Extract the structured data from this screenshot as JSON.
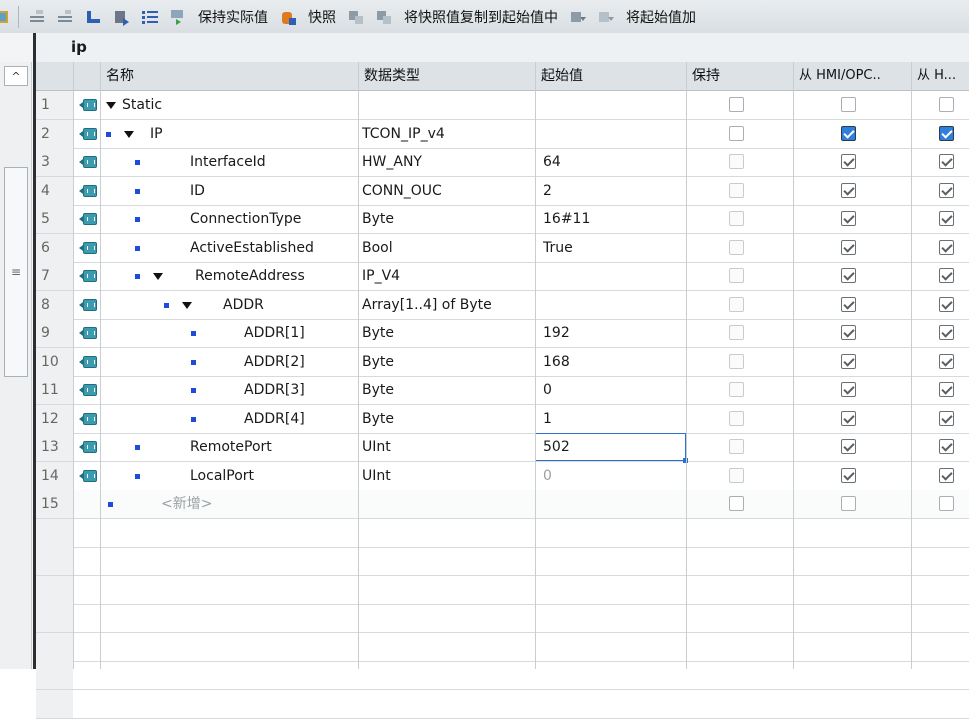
{
  "toolbar": {
    "keep_actual_label": "保持实际值",
    "snapshot_label": "快照",
    "copy_snapshot_label": "将快照值复制到起始值中",
    "load_start_label": "将起始值加"
  },
  "block": {
    "name": "ip"
  },
  "table": {
    "headers": {
      "name": "名称",
      "datatype": "数据类型",
      "start_value": "起始值",
      "retain": "保持",
      "hmi_opc": "从 HMI/OPC..",
      "hmi2": "从 H..."
    },
    "rows": [
      {
        "num": "1",
        "name": "Static",
        "type": "",
        "value": "",
        "retain": "off",
        "hmi": "off",
        "h": "off"
      },
      {
        "num": "2",
        "name": "IP",
        "type": "TCON_IP_v4",
        "value": "",
        "retain": "off",
        "hmi": "on",
        "h": "on"
      },
      {
        "num": "3",
        "name": "InterfaceId",
        "type": "HW_ANY",
        "value": "64",
        "retain": "off",
        "hmi": "on",
        "h": "on"
      },
      {
        "num": "4",
        "name": "ID",
        "type": "CONN_OUC",
        "value": "2",
        "retain": "off",
        "hmi": "on",
        "h": "on"
      },
      {
        "num": "5",
        "name": "ConnectionType",
        "type": "Byte",
        "value": "16#11",
        "retain": "off",
        "hmi": "on",
        "h": "on"
      },
      {
        "num": "6",
        "name": "ActiveEstablished",
        "type": "Bool",
        "value": "True",
        "retain": "off",
        "hmi": "on",
        "h": "on"
      },
      {
        "num": "7",
        "name": "RemoteAddress",
        "type": "IP_V4",
        "value": "",
        "retain": "off",
        "hmi": "on",
        "h": "on"
      },
      {
        "num": "8",
        "name": "ADDR",
        "type": "Array[1..4] of Byte",
        "value": "",
        "retain": "off",
        "hmi": "on",
        "h": "on"
      },
      {
        "num": "9",
        "name": "ADDR[1]",
        "type": "Byte",
        "value": "192",
        "retain": "off",
        "hmi": "on",
        "h": "on"
      },
      {
        "num": "10",
        "name": "ADDR[2]",
        "type": "Byte",
        "value": "168",
        "retain": "off",
        "hmi": "on",
        "h": "on"
      },
      {
        "num": "11",
        "name": "ADDR[3]",
        "type": "Byte",
        "value": "0",
        "retain": "off",
        "hmi": "on",
        "h": "on"
      },
      {
        "num": "12",
        "name": "ADDR[4]",
        "type": "Byte",
        "value": "1",
        "retain": "off",
        "hmi": "on",
        "h": "on"
      },
      {
        "num": "13",
        "name": "RemotePort",
        "type": "UInt",
        "value": "502",
        "retain": "off",
        "hmi": "on",
        "h": "on"
      },
      {
        "num": "14",
        "name": "LocalPort",
        "type": "UInt",
        "value": "0",
        "retain": "off",
        "hmi": "on",
        "h": "on"
      },
      {
        "num": "15",
        "name": "<新增>",
        "type": "",
        "value": "",
        "retain": "off",
        "hmi": "off",
        "h": "off"
      }
    ]
  },
  "colors": {
    "accent": "#2f7fe0",
    "header_bg": "#dde2e6",
    "row_num_bg": "#eef0f1"
  }
}
